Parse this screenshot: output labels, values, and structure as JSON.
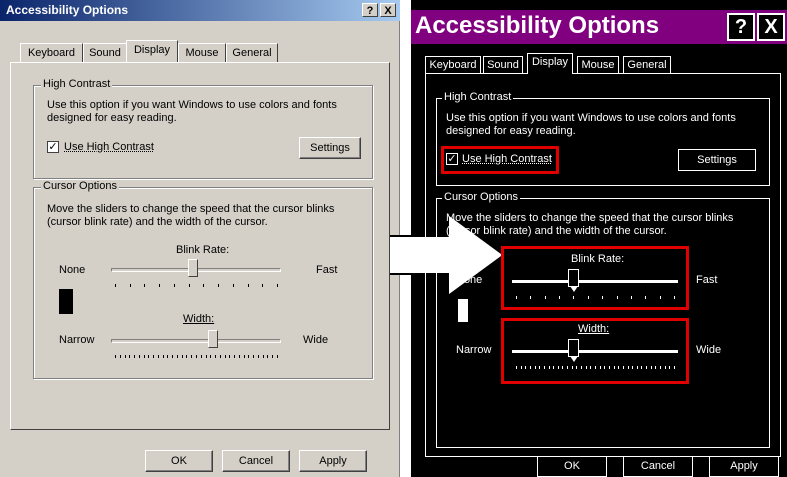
{
  "left_window": {
    "title": "Accessibility Options",
    "help_button": "?",
    "close_button": "X",
    "tabs": [
      "Keyboard",
      "Sound",
      "Display",
      "Mouse",
      "General"
    ],
    "active_tab": "Display",
    "high_contrast": {
      "group_label": "High Contrast",
      "description_line1": "Use this option if you want Windows to use colors and fonts",
      "description_line2": "designed for easy reading.",
      "checkbox_label": "Use High Contrast",
      "checked": true,
      "settings_button": "Settings"
    },
    "cursor_options": {
      "group_label": "Cursor Options",
      "description_line1": "Move the sliders to change the speed that the cursor blinks",
      "description_line2": "(cursor blink rate) and the width of the cursor.",
      "blink_rate_label": "Blink Rate:",
      "blink_min": "None",
      "blink_max": "Fast",
      "blink_value_fraction": 0.48,
      "width_label": "Width:",
      "width_min": "Narrow",
      "width_max": "Wide",
      "width_value_fraction": 0.6
    },
    "buttons": {
      "ok": "OK",
      "cancel": "Cancel",
      "apply": "Apply"
    }
  },
  "right_window": {
    "title": "Accessibility Options",
    "help_button": "?",
    "close_button": "X",
    "tabs": [
      "Keyboard",
      "Sound",
      "Display",
      "Mouse",
      "General"
    ],
    "active_tab": "Display",
    "high_contrast": {
      "group_label": "High Contrast",
      "description_line1": "Use this option if you want Windows to use colors and fonts",
      "description_line2": "designed for easy reading.",
      "checkbox_label": "Use High Contrast",
      "checked": true,
      "settings_button": "Settings"
    },
    "cursor_options": {
      "group_label": "Cursor Options",
      "description_line1": "Move the sliders to change the speed that the cursor blinks",
      "description_line2": "(cursor blink rate) and the width of the cursor.",
      "blink_rate_label": "Blink Rate:",
      "blink_min": "None",
      "blink_max": "Fast",
      "blink_value_fraction": 0.37,
      "width_label": "Width:",
      "width_min": "Narrow",
      "width_max": "Wide",
      "width_value_fraction": 0.37
    },
    "buttons": {
      "ok": "OK",
      "cancel": "Cancel",
      "apply": "Apply"
    }
  },
  "colors": {
    "classic_face": "#d4d0c8",
    "classic_title_start": "#0a246a",
    "hc_background": "#000000",
    "hc_foreground": "#ffffff",
    "hc_title": "#800080",
    "highlight": "#e00000"
  }
}
